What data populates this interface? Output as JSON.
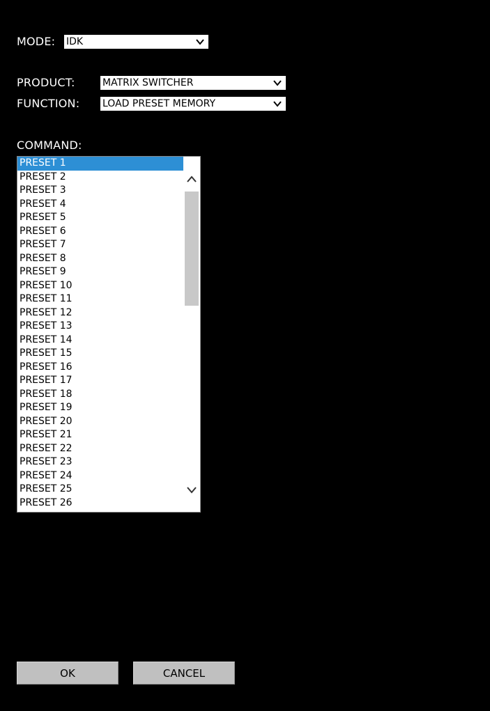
{
  "mode": {
    "label": "MODE:",
    "value": "IDK"
  },
  "product": {
    "label": "PRODUCT:",
    "value": "MATRIX SWITCHER"
  },
  "function": {
    "label": "FUNCTION:",
    "value": "LOAD PRESET MEMORY"
  },
  "command": {
    "label": "COMMAND:",
    "selected_index": 0,
    "items": [
      "PRESET 1",
      "PRESET 2",
      "PRESET 3",
      "PRESET 4",
      "PRESET 5",
      "PRESET 6",
      "PRESET 7",
      "PRESET 8",
      "PRESET 9",
      "PRESET 10",
      "PRESET 11",
      "PRESET 12",
      "PRESET 13",
      "PRESET 14",
      "PRESET 15",
      "PRESET 16",
      "PRESET 17",
      "PRESET 18",
      "PRESET 19",
      "PRESET 20",
      "PRESET 21",
      "PRESET 22",
      "PRESET 23",
      "PRESET 24",
      "PRESET 25",
      "PRESET 26"
    ]
  },
  "buttons": {
    "ok": "OK",
    "cancel": "CANCEL"
  },
  "colors": {
    "background": "#000000",
    "selection": "#2d8fd5",
    "button": "#c0c0c0"
  }
}
